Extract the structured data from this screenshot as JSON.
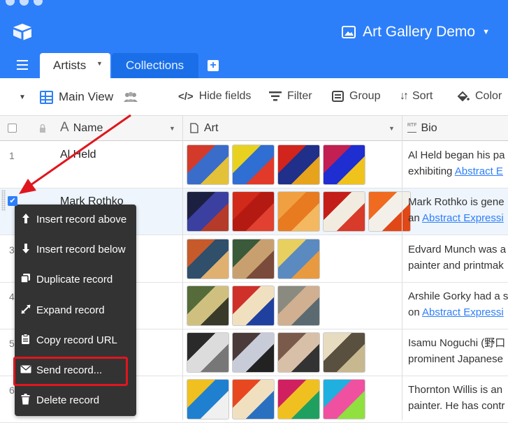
{
  "app": {
    "base_name": "Art Gallery Demo",
    "colors": {
      "header": "#2d7ff9",
      "accent": "#2d7ff9",
      "menu_bg": "#333333",
      "highlight": "#e0161e"
    }
  },
  "tabs": [
    {
      "label": "Artists",
      "active": true
    },
    {
      "label": "Collections",
      "active": false
    }
  ],
  "toolbar": {
    "view_name": "Main View",
    "hide_fields": "Hide fields",
    "filter": "Filter",
    "group": "Group",
    "sort": "Sort",
    "color": "Color"
  },
  "columns": {
    "name": "Name",
    "art": "Art",
    "bio": "Bio",
    "bio_type_badge": "RTF"
  },
  "rows": [
    {
      "num": "1",
      "name": "Al Held",
      "bio1": "Al Held began his pa",
      "bio2_pre": "exhibiting ",
      "bio2_link": "Abstract E"
    },
    {
      "num": "",
      "name": "Mark Rothko",
      "bio1": "Mark Rothko is gene",
      "bio2_pre": "an ",
      "bio2_link": "Abstract Expressi"
    },
    {
      "num": "3",
      "name": "",
      "bio1": "Edvard Munch was a",
      "bio2_pre": "painter and printmak",
      "bio2_link": ""
    },
    {
      "num": "4",
      "name": "",
      "bio1": "Arshile Gorky had a s",
      "bio2_pre": "on ",
      "bio2_link": "Abstract Expressi"
    },
    {
      "num": "5",
      "name": "",
      "bio1": "Isamu Noguchi (野口",
      "bio2_pre": "prominent Japanese",
      "bio2_link": ""
    },
    {
      "num": "6",
      "name": "",
      "bio1": "Thornton Willis is an",
      "bio2_pre": "painter. He has contr",
      "bio2_link": ""
    }
  ],
  "context_menu": [
    {
      "label": "Insert record above",
      "icon": "arrow-up-icon"
    },
    {
      "label": "Insert record below",
      "icon": "arrow-down-icon"
    },
    {
      "label": "Duplicate record",
      "icon": "duplicate-icon"
    },
    {
      "label": "Expand record",
      "icon": "expand-icon"
    },
    {
      "label": "Copy record URL",
      "icon": "clipboard-icon"
    },
    {
      "label": "Send record...",
      "icon": "envelope-icon"
    },
    {
      "label": "Delete record",
      "icon": "trash-icon"
    }
  ]
}
